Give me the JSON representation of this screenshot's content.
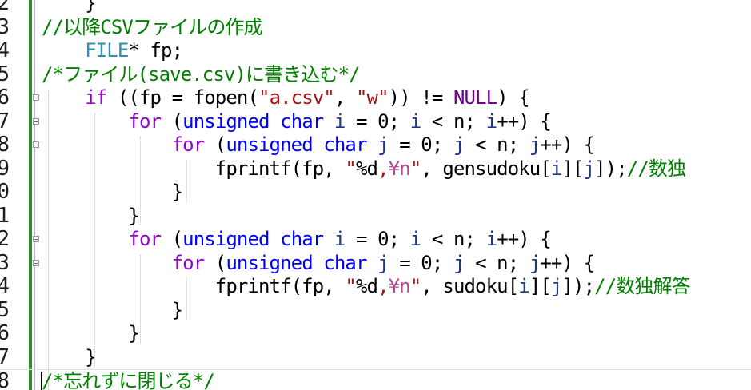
{
  "editor": {
    "lines": [
      {
        "num": "2",
        "fold": false,
        "segments": [
          {
            "text": "    }",
            "color": "#000000"
          }
        ]
      },
      {
        "num": "3",
        "fold": false,
        "segments": [
          {
            "text": "//以降CSVファイルの作成",
            "color": "#008000"
          }
        ]
      },
      {
        "num": "4",
        "fold": false,
        "segments": [
          {
            "text": "    ",
            "color": "#000000"
          },
          {
            "text": "FILE",
            "color": "#2b91af"
          },
          {
            "text": "* fp;",
            "color": "#000000"
          }
        ]
      },
      {
        "num": "5",
        "fold": false,
        "segments": [
          {
            "text": "/*ファイル(save.csv)に書き込む*/",
            "color": "#008000"
          }
        ]
      },
      {
        "num": "6",
        "fold": true,
        "segments": [
          {
            "text": "    ",
            "color": "#000000"
          },
          {
            "text": "if",
            "color": "#8f08c4"
          },
          {
            "text": " ((fp = fopen(",
            "color": "#000000"
          },
          {
            "text": "\"a.csv\"",
            "color": "#a31515"
          },
          {
            "text": ", ",
            "color": "#000000"
          },
          {
            "text": "\"w\"",
            "color": "#a31515"
          },
          {
            "text": ")) != ",
            "color": "#000000"
          },
          {
            "text": "NULL",
            "color": "#6f008a"
          },
          {
            "text": ") {",
            "color": "#000000"
          }
        ]
      },
      {
        "num": "7",
        "fold": true,
        "segments": [
          {
            "text": "        ",
            "color": "#000000"
          },
          {
            "text": "for",
            "color": "#8f08c4"
          },
          {
            "text": " (",
            "color": "#000000"
          },
          {
            "text": "unsigned",
            "color": "#0000ff"
          },
          {
            "text": " ",
            "color": "#000000"
          },
          {
            "text": "char",
            "color": "#0000ff"
          },
          {
            "text": " ",
            "color": "#000000"
          },
          {
            "text": "i",
            "color": "#1f377f"
          },
          {
            "text": " = 0; ",
            "color": "#000000"
          },
          {
            "text": "i",
            "color": "#1f377f"
          },
          {
            "text": " < n; ",
            "color": "#000000"
          },
          {
            "text": "i",
            "color": "#1f377f"
          },
          {
            "text": "++) {",
            "color": "#000000"
          }
        ]
      },
      {
        "num": "8",
        "fold": true,
        "segments": [
          {
            "text": "            ",
            "color": "#000000"
          },
          {
            "text": "for",
            "color": "#8f08c4"
          },
          {
            "text": " (",
            "color": "#000000"
          },
          {
            "text": "unsigned",
            "color": "#0000ff"
          },
          {
            "text": " ",
            "color": "#000000"
          },
          {
            "text": "char",
            "color": "#0000ff"
          },
          {
            "text": " ",
            "color": "#000000"
          },
          {
            "text": "j",
            "color": "#1f377f"
          },
          {
            "text": " = 0; ",
            "color": "#000000"
          },
          {
            "text": "j",
            "color": "#1f377f"
          },
          {
            "text": " < n; ",
            "color": "#000000"
          },
          {
            "text": "j",
            "color": "#1f377f"
          },
          {
            "text": "++) {",
            "color": "#000000"
          }
        ]
      },
      {
        "num": "9",
        "fold": false,
        "segments": [
          {
            "text": "                fprintf(fp, ",
            "color": "#000000"
          },
          {
            "text": "\"",
            "color": "#a31515"
          },
          {
            "text": "%d",
            "color": "#000000"
          },
          {
            "text": ",",
            "color": "#a31515"
          },
          {
            "text": "¥n",
            "color": "#b5488e"
          },
          {
            "text": "\"",
            "color": "#a31515"
          },
          {
            "text": ", gensudoku[",
            "color": "#000000"
          },
          {
            "text": "i",
            "color": "#1f377f"
          },
          {
            "text": "][",
            "color": "#000000"
          },
          {
            "text": "j",
            "color": "#1f377f"
          },
          {
            "text": "]);",
            "color": "#000000"
          },
          {
            "text": "//数独",
            "color": "#008000"
          }
        ]
      },
      {
        "num": "0",
        "fold": false,
        "segments": [
          {
            "text": "            }",
            "color": "#000000"
          }
        ]
      },
      {
        "num": "1",
        "fold": false,
        "segments": [
          {
            "text": "        }",
            "color": "#000000"
          }
        ]
      },
      {
        "num": "2",
        "fold": true,
        "segments": [
          {
            "text": "        ",
            "color": "#000000"
          },
          {
            "text": "for",
            "color": "#8f08c4"
          },
          {
            "text": " (",
            "color": "#000000"
          },
          {
            "text": "unsigned",
            "color": "#0000ff"
          },
          {
            "text": " ",
            "color": "#000000"
          },
          {
            "text": "char",
            "color": "#0000ff"
          },
          {
            "text": " ",
            "color": "#000000"
          },
          {
            "text": "i",
            "color": "#1f377f"
          },
          {
            "text": " = 0; ",
            "color": "#000000"
          },
          {
            "text": "i",
            "color": "#1f377f"
          },
          {
            "text": " < n; ",
            "color": "#000000"
          },
          {
            "text": "i",
            "color": "#1f377f"
          },
          {
            "text": "++) {",
            "color": "#000000"
          }
        ]
      },
      {
        "num": "3",
        "fold": true,
        "segments": [
          {
            "text": "            ",
            "color": "#000000"
          },
          {
            "text": "for",
            "color": "#8f08c4"
          },
          {
            "text": " (",
            "color": "#000000"
          },
          {
            "text": "unsigned",
            "color": "#0000ff"
          },
          {
            "text": " ",
            "color": "#000000"
          },
          {
            "text": "char",
            "color": "#0000ff"
          },
          {
            "text": " ",
            "color": "#000000"
          },
          {
            "text": "j",
            "color": "#1f377f"
          },
          {
            "text": " = 0; ",
            "color": "#000000"
          },
          {
            "text": "j",
            "color": "#1f377f"
          },
          {
            "text": " < n; ",
            "color": "#000000"
          },
          {
            "text": "j",
            "color": "#1f377f"
          },
          {
            "text": "++) {",
            "color": "#000000"
          }
        ]
      },
      {
        "num": "4",
        "fold": false,
        "segments": [
          {
            "text": "                fprintf(fp, ",
            "color": "#000000"
          },
          {
            "text": "\"",
            "color": "#a31515"
          },
          {
            "text": "%d",
            "color": "#000000"
          },
          {
            "text": ",",
            "color": "#a31515"
          },
          {
            "text": "¥n",
            "color": "#b5488e"
          },
          {
            "text": "\"",
            "color": "#a31515"
          },
          {
            "text": ", sudoku[",
            "color": "#000000"
          },
          {
            "text": "i",
            "color": "#1f377f"
          },
          {
            "text": "][",
            "color": "#000000"
          },
          {
            "text": "j",
            "color": "#1f377f"
          },
          {
            "text": "]);",
            "color": "#000000"
          },
          {
            "text": "//数独解答",
            "color": "#008000"
          }
        ]
      },
      {
        "num": "5",
        "fold": false,
        "segments": [
          {
            "text": "            }",
            "color": "#000000"
          }
        ]
      },
      {
        "num": "6",
        "fold": false,
        "segments": [
          {
            "text": "        }",
            "color": "#000000"
          }
        ]
      },
      {
        "num": "7",
        "fold": false,
        "segments": [
          {
            "text": "    }",
            "color": "#000000"
          }
        ]
      },
      {
        "num": "8",
        "fold": false,
        "segments": [
          {
            "text": "/*忘れずに閉じる*/",
            "color": "#008000"
          }
        ]
      }
    ]
  }
}
